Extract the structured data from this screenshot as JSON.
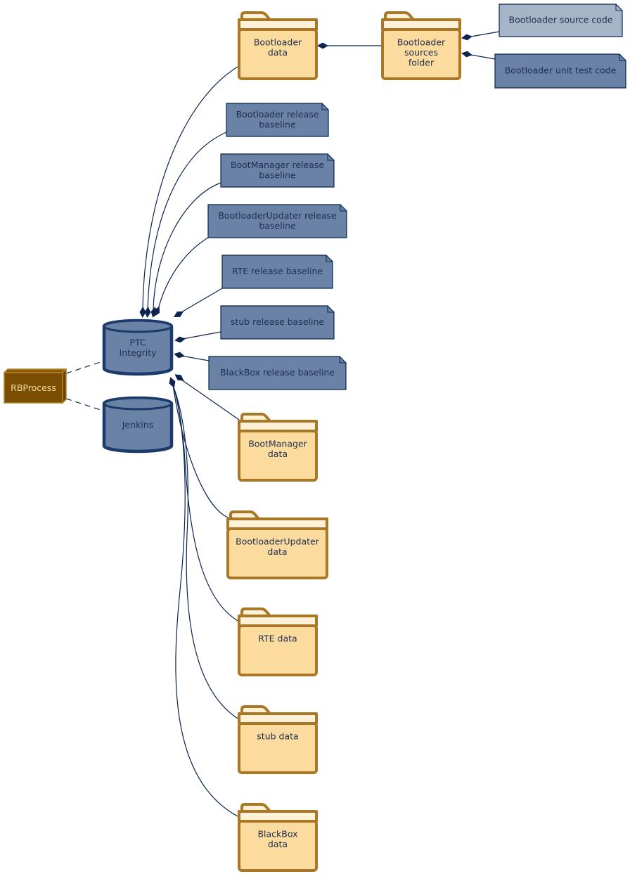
{
  "diagram": {
    "colors": {
      "folder_fill": "#fbdb9e",
      "folder_tab": "#fff0d8",
      "folder_stroke": "#a97826",
      "note_fill": "#6a82a6",
      "note_light_fill": "#a6b4c8",
      "edge": "#0b2450",
      "cylinder_fill": "#6a82a6",
      "cylinder_stroke": "#1c3a6a",
      "node_fill": "#7a4e00",
      "node_text": "#f5d9a0"
    },
    "nodes": {
      "rbprocess": {
        "label": [
          "RBProcess"
        ],
        "kind": "node"
      },
      "ptc_integrity": {
        "label": [
          "PTC",
          "Integrity"
        ],
        "kind": "database"
      },
      "jenkins": {
        "label": [
          "Jenkins"
        ],
        "kind": "database"
      },
      "bootloader_data": {
        "label": [
          "Bootloader",
          "data"
        ],
        "kind": "folder"
      },
      "bootloader_sources_folder": {
        "label": [
          "Bootloader",
          "sources",
          "folder"
        ],
        "kind": "folder"
      },
      "bootloader_source_code": {
        "label": [
          "Bootloader source code"
        ],
        "kind": "artifact"
      },
      "bootloader_unit_test_code": {
        "label": [
          "Bootloader unit test code"
        ],
        "kind": "artifact"
      },
      "bootloader_release_baseline": {
        "label": [
          "Bootloader release",
          "baseline"
        ],
        "kind": "artifact"
      },
      "bootmanager_release_baseline": {
        "label": [
          "BootManager release",
          "baseline"
        ],
        "kind": "artifact"
      },
      "bootloaderupdater_release_baseline": {
        "label": [
          "BootloaderUpdater release",
          "baseline"
        ],
        "kind": "artifact"
      },
      "rte_release_baseline": {
        "label": [
          "RTE release baseline"
        ],
        "kind": "artifact"
      },
      "stub_release_baseline": {
        "label": [
          "stub release baseline"
        ],
        "kind": "artifact"
      },
      "blackbox_release_baseline": {
        "label": [
          "BlackBox release baseline"
        ],
        "kind": "artifact"
      },
      "bootmanager_data": {
        "label": [
          "BootManager",
          "data"
        ],
        "kind": "folder"
      },
      "bootloaderupdater_data": {
        "label": [
          "BootloaderUpdater",
          "data"
        ],
        "kind": "folder"
      },
      "rte_data": {
        "label": [
          "RTE data"
        ],
        "kind": "folder"
      },
      "stub_data": {
        "label": [
          "stub data"
        ],
        "kind": "folder"
      },
      "blackbox_data": {
        "label": [
          "BlackBox",
          "data"
        ],
        "kind": "folder"
      }
    },
    "edges": [
      {
        "from": "rbprocess",
        "to": "ptc_integrity",
        "type": "dependency"
      },
      {
        "from": "rbprocess",
        "to": "jenkins",
        "type": "dependency"
      },
      {
        "from": "ptc_integrity",
        "to": "bootloader_data",
        "type": "composition"
      },
      {
        "from": "ptc_integrity",
        "to": "bootloader_release_baseline",
        "type": "composition"
      },
      {
        "from": "ptc_integrity",
        "to": "bootmanager_release_baseline",
        "type": "composition"
      },
      {
        "from": "ptc_integrity",
        "to": "bootloaderupdater_release_baseline",
        "type": "composition"
      },
      {
        "from": "ptc_integrity",
        "to": "rte_release_baseline",
        "type": "composition"
      },
      {
        "from": "ptc_integrity",
        "to": "stub_release_baseline",
        "type": "composition"
      },
      {
        "from": "ptc_integrity",
        "to": "blackbox_release_baseline",
        "type": "composition"
      },
      {
        "from": "ptc_integrity",
        "to": "bootmanager_data",
        "type": "composition"
      },
      {
        "from": "ptc_integrity",
        "to": "bootloaderupdater_data",
        "type": "composition"
      },
      {
        "from": "ptc_integrity",
        "to": "rte_data",
        "type": "composition"
      },
      {
        "from": "ptc_integrity",
        "to": "stub_data",
        "type": "composition"
      },
      {
        "from": "ptc_integrity",
        "to": "blackbox_data",
        "type": "composition"
      },
      {
        "from": "bootloader_data",
        "to": "bootloader_sources_folder",
        "type": "composition"
      },
      {
        "from": "bootloader_sources_folder",
        "to": "bootloader_source_code",
        "type": "composition"
      },
      {
        "from": "bootloader_sources_folder",
        "to": "bootloader_unit_test_code",
        "type": "composition"
      }
    ]
  }
}
